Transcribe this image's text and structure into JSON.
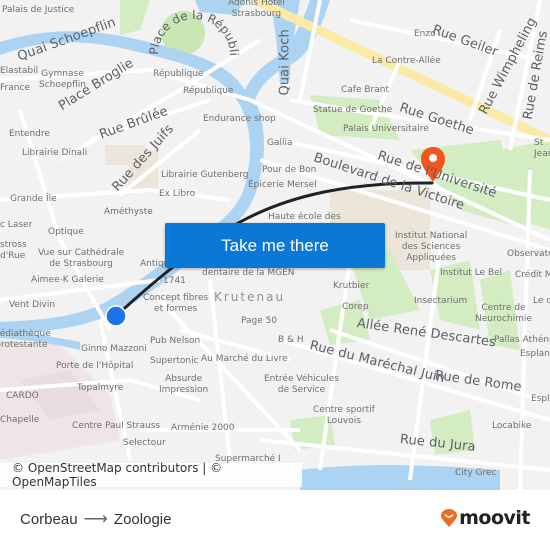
{
  "map": {
    "streets": [
      {
        "key": "quai_schoepflin",
        "text": "Quai Schoepflin"
      },
      {
        "key": "place_de_la_republique",
        "text": "Place de la République"
      },
      {
        "key": "place_broglie",
        "text": "Place Broglie"
      },
      {
        "key": "rue_brulee",
        "text": "Rue Brûlée"
      },
      {
        "key": "rue_des_juifs",
        "text": "Rue des Juifs"
      },
      {
        "key": "quai_koch",
        "text": "Quai Koch"
      },
      {
        "key": "rue_geiler",
        "text": "Rue Geiler"
      },
      {
        "key": "rue_wimpheling",
        "text": "Rue Wimpheling"
      },
      {
        "key": "rue_de_reims",
        "text": "Rue de Reims"
      },
      {
        "key": "rue_goethe",
        "text": "Rue Goethe"
      },
      {
        "key": "rue_de_l_universite",
        "text": "Rue de l'Université"
      },
      {
        "key": "boulevard_de_la_victoire",
        "text": "Boulevard de la Victoire"
      },
      {
        "key": "allee_rene_descartes",
        "text": "Allée René Descartes"
      },
      {
        "key": "rue_du_marechal_juin",
        "text": "Rue du Maréchal Juin"
      },
      {
        "key": "rue_de_rome",
        "text": "Rue de Rome"
      },
      {
        "key": "rue_du_jura",
        "text": "Rue du Jura"
      }
    ],
    "district": "Krutenau",
    "pois": [
      {
        "key": "palais_de_justice",
        "text": "Palais de Justice"
      },
      {
        "key": "adonis_hotel",
        "text": "Adonis Hotel\nStrasbourg"
      },
      {
        "key": "enzo",
        "text": "Enzo"
      },
      {
        "key": "la_contre_allee",
        "text": "La Contre-Allée"
      },
      {
        "key": "elastabil",
        "text": "Elastabil"
      },
      {
        "key": "gymnase_schoepflin",
        "text": "Gymnase\nSchoepflin"
      },
      {
        "key": "france",
        "text": "France"
      },
      {
        "key": "republique_1",
        "text": "République"
      },
      {
        "key": "republique_2",
        "text": "République"
      },
      {
        "key": "cafe_brant",
        "text": "Cafe Brant"
      },
      {
        "key": "statue_de_goethe",
        "text": "Statue de Goethe"
      },
      {
        "key": "palais_universitaire",
        "text": "Palais Universitaire"
      },
      {
        "key": "endurance_shop",
        "text": "Endurance shop"
      },
      {
        "key": "entendre",
        "text": "Entendre"
      },
      {
        "key": "librairie_dinali",
        "text": "Librairie Dinali"
      },
      {
        "key": "gallia",
        "text": "Gallia"
      },
      {
        "key": "pour_de_bon",
        "text": "Pour de Bon"
      },
      {
        "key": "librairie_gutenberg",
        "text": "Librairie Gutenberg"
      },
      {
        "key": "epicerie_mersel",
        "text": "Épicerie Mersel"
      },
      {
        "key": "ex_libro",
        "text": "Ex Libro"
      },
      {
        "key": "grande_ile",
        "text": "Grande Île"
      },
      {
        "key": "amethyste",
        "text": "Améthyste"
      },
      {
        "key": "haute_ecole",
        "text": "Haute école des"
      },
      {
        "key": "laser",
        "text": "c Laser"
      },
      {
        "key": "optique",
        "text": "Optique"
      },
      {
        "key": "stross",
        "text": "stross\nd'Rue"
      },
      {
        "key": "vue_sur_cathedrale",
        "text": "Vue sur Cathédrale\nde Strasbourg"
      },
      {
        "key": "aimee_k",
        "text": "Aimee-K Galerie"
      },
      {
        "key": "antiqu",
        "text": "Antiqu"
      },
      {
        "key": "dentaire",
        "text": "dentaire de la MGEN"
      },
      {
        "key": "n1741",
        "text": "1741"
      },
      {
        "key": "concept_fibres",
        "text": "Concept fibres\net formes"
      },
      {
        "key": "vent_divin",
        "text": "Vent Divin"
      },
      {
        "key": "mediatheque",
        "text": "Médiathèque\nprotestante"
      },
      {
        "key": "ginno_mazzoni",
        "text": "Ginno Mazzoni"
      },
      {
        "key": "pub_nelson",
        "text": "Pub Nelson"
      },
      {
        "key": "page_50",
        "text": "Page 50"
      },
      {
        "key": "b_h",
        "text": "B & H"
      },
      {
        "key": "krutbier",
        "text": "Krutbier"
      },
      {
        "key": "corep",
        "text": "Corep"
      },
      {
        "key": "porte_de_l_hopital",
        "text": "Porte de l'Hôpital"
      },
      {
        "key": "supertonic",
        "text": "Supertonic"
      },
      {
        "key": "au_marche_du_livre",
        "text": "Au Marché du Livre"
      },
      {
        "key": "topalmyre",
        "text": "Topalmyre"
      },
      {
        "key": "absurde_impression",
        "text": "Absurde\nImpression"
      },
      {
        "key": "entree_vehicules",
        "text": "Entrée Véhicules\nde Service"
      },
      {
        "key": "cardo",
        "text": "CARDO"
      },
      {
        "key": "chapelle",
        "text": "Chapelle"
      },
      {
        "key": "centre_paul_strauss",
        "text": "Centre Paul Strauss"
      },
      {
        "key": "armenie_2000",
        "text": "Arménie 2000"
      },
      {
        "key": "centre_sportif_louvois",
        "text": "Centre sportif\nLouvois"
      },
      {
        "key": "selectour",
        "text": "Selectour"
      },
      {
        "key": "supermarche",
        "text": "Supermarché I"
      },
      {
        "key": "locabike",
        "text": "Locabike"
      },
      {
        "key": "city_grec",
        "text": "City Grec"
      },
      {
        "key": "institut_national",
        "text": "Institut National\ndes Sciences\nAppliquées"
      },
      {
        "key": "observato",
        "text": "Observato"
      },
      {
        "key": "institut_le_bel",
        "text": "Institut Le Bel"
      },
      {
        "key": "credit_m",
        "text": "Crédit M"
      },
      {
        "key": "insectarium",
        "text": "Insectarium"
      },
      {
        "key": "le_c",
        "text": "Le c"
      },
      {
        "key": "centre_de_neurochimie",
        "text": "Centre de\nNeurochimie"
      },
      {
        "key": "pallas_athene",
        "text": "Pallas Athéné"
      },
      {
        "key": "esplana_1",
        "text": "Esplana"
      },
      {
        "key": "espla_2",
        "text": "Espla"
      },
      {
        "key": "sta_jean",
        "text": "St\nJean"
      }
    ],
    "origin_marker_color": "#1a73e8",
    "destination_marker_color": "#f1571c",
    "route_color": "#222222"
  },
  "cta": {
    "label": "Take me there",
    "color": "#0b77d6"
  },
  "attribution": "© OpenStreetMap contributors | © OpenMapTiles",
  "footer": {
    "origin": "Corbeau",
    "arrow": "⟶",
    "destination": "Zoologie",
    "brand": "moovit",
    "brand_color": "#f26b21"
  }
}
